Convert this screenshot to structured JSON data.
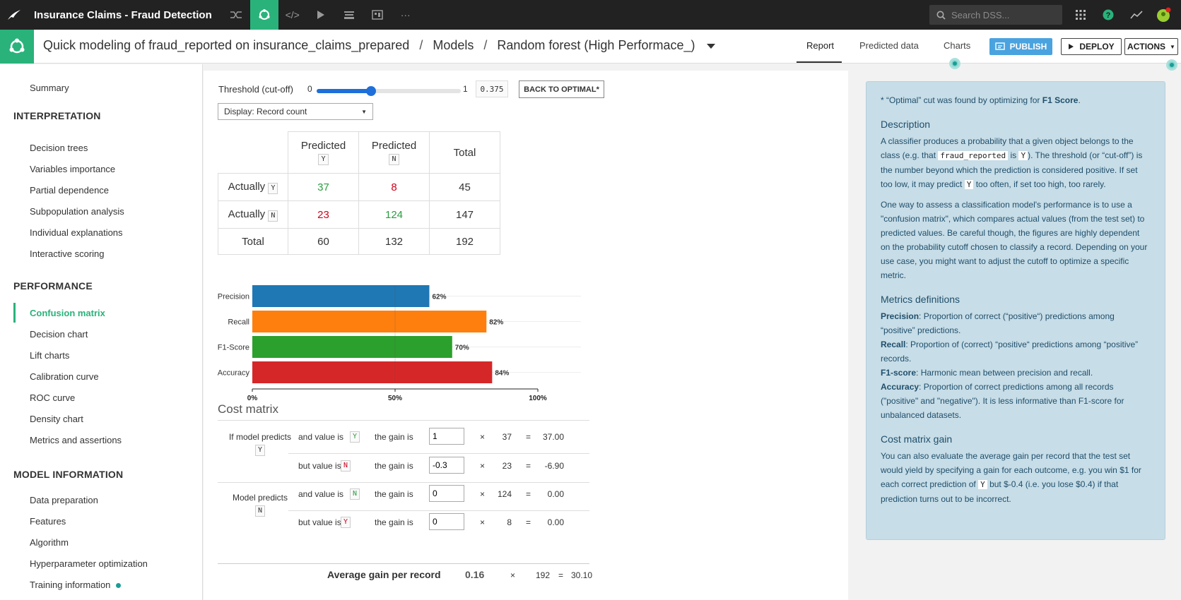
{
  "topbar": {
    "app_title": "Insurance Claims - Fraud Detection",
    "search_placeholder": "Search DSS..."
  },
  "header": {
    "breadcrumb_project": "Quick modeling of fraud_reported on insurance_claims_prepared",
    "breadcrumb_sep": "/",
    "breadcrumb_models": "Models",
    "breadcrumb_model": "Random forest (High Performace_)",
    "tabs": [
      "Report",
      "Predicted data",
      "Charts"
    ],
    "publish_label": "PUBLISH",
    "deploy_label": "DEPLOY",
    "actions_label": "ACTIONS"
  },
  "sidebar": {
    "summary": "Summary",
    "sections": [
      {
        "title": "INTERPRETATION",
        "items": [
          "Decision trees",
          "Variables importance",
          "Partial dependence",
          "Subpopulation analysis",
          "Individual explanations",
          "Interactive scoring"
        ]
      },
      {
        "title": "PERFORMANCE",
        "items": [
          "Confusion matrix",
          "Decision chart",
          "Lift charts",
          "Calibration curve",
          "ROC curve",
          "Density chart",
          "Metrics and assertions"
        ]
      },
      {
        "title": "MODEL INFORMATION",
        "items": [
          "Data preparation",
          "Features",
          "Algorithm",
          "Hyperparameter optimization",
          "Training information"
        ]
      }
    ],
    "active_item": "Confusion matrix"
  },
  "threshold": {
    "label": "Threshold (cut-off)",
    "min_label": "0",
    "max_label": "1",
    "value": "0.375",
    "value_fraction": 0.375,
    "back_button": "BACK TO OPTIMAL*"
  },
  "display_select": {
    "value": "Display: Record count"
  },
  "confusion_matrix": {
    "predicted_label": "Predicted",
    "actually_label": "Actually",
    "total_label": "Total",
    "y": "Y",
    "n": "N",
    "rows": [
      {
        "cells": [
          "37",
          "8",
          "45"
        ]
      },
      {
        "cells": [
          "23",
          "124",
          "147"
        ]
      },
      {
        "cells": [
          "60",
          "132",
          "192"
        ]
      }
    ]
  },
  "chart_data": {
    "type": "bar",
    "orientation": "horizontal",
    "categories": [
      "Precision",
      "Recall",
      "F1-Score",
      "Accuracy"
    ],
    "values": [
      62,
      82,
      70,
      84
    ],
    "value_labels": [
      "62%",
      "82%",
      "70%",
      "84%"
    ],
    "colors": [
      "#1f77b4",
      "#ff7f0e",
      "#2ca02c",
      "#d62728"
    ],
    "xlim": [
      0,
      100
    ],
    "xticks": [
      "0%",
      "50%",
      "100%"
    ]
  },
  "cost_matrix": {
    "title": "Cost matrix",
    "group1_label": "If model predicts",
    "group2_label": "Model predicts",
    "and_value_is": "and value is",
    "but_value_is": "but value is",
    "gain_is": "the gain is",
    "times": "×",
    "equals": "=",
    "rows": [
      {
        "pill": "Y",
        "gain": "1",
        "count": "37",
        "result": "37.00"
      },
      {
        "pill": "N",
        "gain": "-0.3",
        "count": "23",
        "result": "-6.90"
      },
      {
        "pill": "N",
        "gain": "0",
        "count": "124",
        "result": "0.00"
      },
      {
        "pill": "Y",
        "gain": "0",
        "count": "8",
        "result": "0.00"
      }
    ],
    "average_label": "Average gain per record",
    "average_value": "0.16",
    "average_count": "192",
    "average_result": "30.10"
  },
  "help": {
    "optimal_note_prefix": "* “Optimal” cut was found by optimizing for",
    "optimal_metric": "F1 Score",
    "description_title": "Description",
    "description_1a": "A classifier produces a probability that a given object belongs to the class (e.g. that",
    "description_code1": "fraud_reported",
    "description_1b": "is",
    "description_code2": "Y",
    "description_1c": "). The threshold (or “cut-off”) is the number beyond which the prediction is considered positive. If set too low, it may predict",
    "description_code3": "Y",
    "description_1d": "too often, if set too high, too rarely.",
    "description_2": "One way to assess a classification model's performance is to use a \"confusion matrix\", which compares actual values (from the test set) to predicted values. Be careful though, the figures are highly dependent on the probability cutoff chosen to classify a record. Depending on your use case, you might want to adjust the cutoff to optimize a specific metric.",
    "metrics_title": "Metrics definitions",
    "m_precision_b": "Precision",
    "m_precision": ": Proportion of correct (“positive“) predictions among “positive” predictions.",
    "m_recall_b": "Recall",
    "m_recall": ": Proportion of (correct) “positive“ predictions among “positive” records.",
    "m_f1_b": "F1-score",
    "m_f1": ": Harmonic mean between precision and recall.",
    "m_acc_b": "Accuracy",
    "m_acc": ": Proportion of correct predictions among all records (\"positive\" and \"negative\"). It is less informative than F1-score for unbalanced datasets.",
    "cost_title": "Cost matrix gain",
    "cost_1a": "You can also evaluate the average gain per record that the test set would yield by specifying a gain for each outcome, e.g. you win $1 for each correct prediction of",
    "cost_code": "Y",
    "cost_1b": "but $-0.4 (i.e. you lose $0.4) if that prediction turns out to be incorrect."
  }
}
